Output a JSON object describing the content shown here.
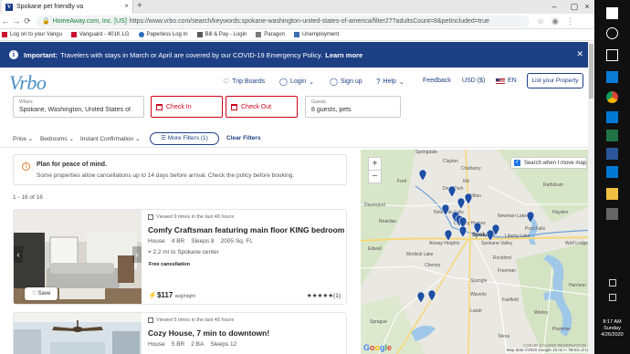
{
  "browser": {
    "tab_title": "Spokane pet friendly va",
    "tab_favicon": "V",
    "url_org": "HomeAway.com, Inc. [US]",
    "url": "https://www.vrbo.com/search/keywords:spokane-washington-united-states-of-america/filter27?adultsCount=8&petIncluded=true",
    "bookmarks": [
      {
        "label": "Log on to your Vangu",
        "icon": "vanguard-icon"
      },
      {
        "label": "Vanguard - 401K LG",
        "icon": "vanguard-icon"
      },
      {
        "label": "Paperless Log In",
        "icon": "paperless-icon"
      },
      {
        "label": "Bill & Pay - Login",
        "icon": "bill-pay-icon"
      },
      {
        "label": "Paragon",
        "icon": "paragon-icon"
      },
      {
        "label": "Unemployment",
        "icon": "unemployment-icon"
      }
    ]
  },
  "banner": {
    "important": "Important:",
    "text": "Travelers with stays in March or April are covered by our COVID-19 Emergency Policy.",
    "link": "Learn more"
  },
  "header": {
    "logo": "Vrbo",
    "trip_boards": "Trip Boards",
    "login": "Login",
    "signup": "Sign up",
    "help": "Help",
    "feedback": "Feedback",
    "currency": "USD ($)",
    "language": "EN",
    "list_property": "List your Property"
  },
  "search": {
    "where_label": "Where",
    "where_value": "Spokane, Washington, United States of A",
    "check_in": "Check In",
    "check_out": "Check Out",
    "guests_label": "Guests",
    "guests_value": "8 guests, pets"
  },
  "filters": {
    "price": "Price",
    "bedrooms": "Bedrooms",
    "instant": "Instant Confirmation",
    "more": "More Filters (1)",
    "clear": "Clear Filters"
  },
  "plan": {
    "title": "Plan for peace of mind.",
    "text": "Some properties allow cancellations up to 14 days before arrival. Check the policy before booking."
  },
  "results_count": "1 - 16 of 16",
  "listings": [
    {
      "viewed": "Viewed 9 times in the last 48 hours",
      "title": "Comfy Craftsman featuring main floor KING bedroom ne...",
      "type": "House",
      "beds": "4 BR",
      "sleeps": "Sleeps 8",
      "sqft": "2005 Sq. Ft.",
      "distance": "2.2 mi to Spokane center",
      "cancel": "Free cancellation",
      "price": "$117",
      "price_unit": "avg/night",
      "stars": "★★★★★",
      "reviews": "(1)",
      "save": "Save"
    },
    {
      "viewed": "Viewed 5 times in the last 48 hours",
      "title": "Cozy House, 7 min to downtown!",
      "type": "House",
      "beds": "5 BR",
      "baths": "2 BA",
      "sleeps": "Sleeps 12"
    }
  ],
  "map": {
    "search_move": "Search when I move map",
    "zoom_in": "+",
    "zoom_out": "−",
    "footer": "Map data ©2020 Google   10 mi ⊢   Terms of Use",
    "place_labels": [
      "Clayton",
      "Chattaroy",
      "Elk",
      "Deer Park",
      "Milan",
      "Nine Mile Falls",
      "Country Homes",
      "Newman Lake",
      "Airway Heights",
      "Spokane",
      "Spokane Valley",
      "Liberty Lake",
      "Post Falls",
      "Cheney",
      "Medical Lake",
      "Rockford",
      "Freeman",
      "Fairfield",
      "Latah",
      "Spangle",
      "Rathdrum",
      "Hayden",
      "Wolf Lodge",
      "Worley",
      "Plummer",
      "Sprague",
      "Tekoa",
      "Reardan",
      "Springdale",
      "Ford",
      "Davenport",
      "Edwall",
      "Waverly",
      "Harrison",
      "COEUR D'ALENE RESERVATION"
    ],
    "google": "Google"
  },
  "taskbar": {
    "time": "8:17 AM",
    "day": "Sunday",
    "date": "4/26/2020"
  }
}
